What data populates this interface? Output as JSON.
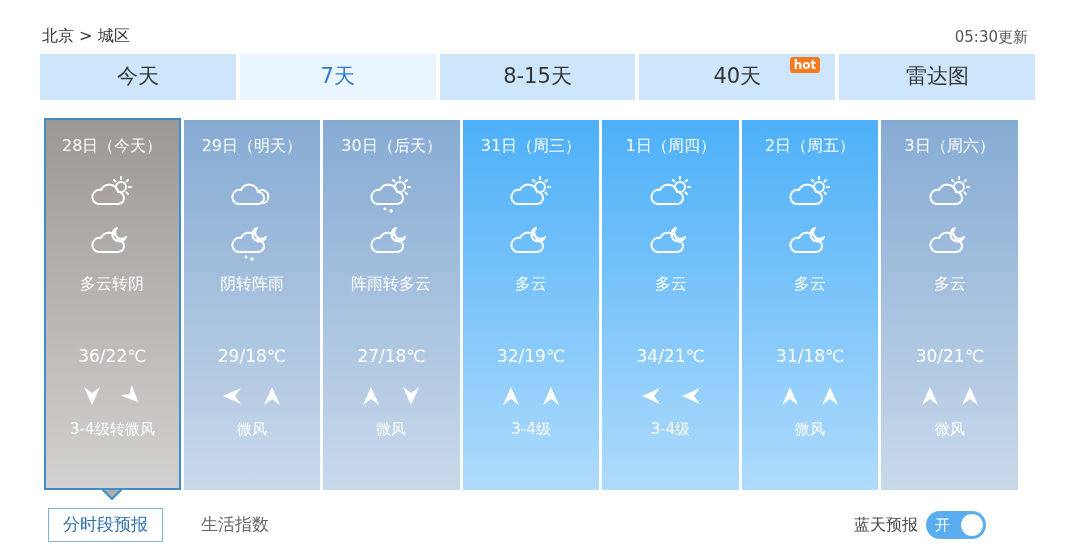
{
  "breadcrumb": "北京 > 城区",
  "updated": "05:30更新",
  "tabs": [
    {
      "label": "今天",
      "selected": false
    },
    {
      "label": "7天",
      "selected": true
    },
    {
      "label": "8-15天",
      "selected": false
    },
    {
      "label": "40天",
      "selected": false,
      "badge": "hot"
    },
    {
      "label": "雷达图",
      "selected": false
    }
  ],
  "days": [
    {
      "date": "28日（今天）",
      "selected": true,
      "color": "#9d9894",
      "icons": [
        {
          "kind": "suncloud"
        },
        {
          "kind": "mooncloud"
        }
      ],
      "weather": "多云转阴",
      "temp": "36/22℃",
      "winds": [
        {
          "kind": "south"
        },
        {
          "kind": "southeast"
        }
      ],
      "wind": "3-4级转微风"
    },
    {
      "date": "29日（明天）",
      "selected": false,
      "color": "#86abd3",
      "icons": [
        {
          "kind": "cloud"
        },
        {
          "kind": "moonrain"
        }
      ],
      "weather": "阴转阵雨",
      "temp": "29/18℃",
      "winds": [
        {
          "kind": "west"
        },
        {
          "kind": "north"
        }
      ],
      "wind": "微风"
    },
    {
      "date": "30日（后天）",
      "selected": false,
      "color": "#86abd3",
      "icons": [
        {
          "kind": "sunrain"
        },
        {
          "kind": "mooncloud"
        }
      ],
      "weather": "阵雨转多云",
      "temp": "27/18℃",
      "winds": [
        {
          "kind": "north"
        },
        {
          "kind": "south"
        }
      ],
      "wind": "微风"
    },
    {
      "date": "31日（周三）",
      "selected": false,
      "color": "#4db0f8",
      "icons": [
        {
          "kind": "suncloud"
        },
        {
          "kind": "mooncloud"
        }
      ],
      "weather": "多云",
      "temp": "32/19℃",
      "winds": [
        {
          "kind": "north"
        },
        {
          "kind": "north"
        }
      ],
      "wind": "3-4级"
    },
    {
      "date": "1日（周四）",
      "selected": false,
      "color": "#4db0f8",
      "icons": [
        {
          "kind": "suncloud"
        },
        {
          "kind": "mooncloud"
        }
      ],
      "weather": "多云",
      "temp": "34/21℃",
      "winds": [
        {
          "kind": "west"
        },
        {
          "kind": "west"
        }
      ],
      "wind": "3-4级"
    },
    {
      "date": "2日（周五）",
      "selected": false,
      "color": "#4db0f8",
      "icons": [
        {
          "kind": "suncloud"
        },
        {
          "kind": "mooncloud"
        }
      ],
      "weather": "多云",
      "temp": "31/18℃",
      "winds": [
        {
          "kind": "north"
        },
        {
          "kind": "north"
        }
      ],
      "wind": "微风"
    },
    {
      "date": "3日（周六）",
      "selected": false,
      "color": "#86abd3",
      "icons": [
        {
          "kind": "suncloud"
        },
        {
          "kind": "mooncloud"
        }
      ],
      "weather": "多云",
      "temp": "30/21℃",
      "winds": [
        {
          "kind": "north"
        },
        {
          "kind": "north"
        }
      ],
      "wind": "微风"
    }
  ],
  "sub_tabs": [
    {
      "label": "分时段预报",
      "selected": true
    },
    {
      "label": "生活指数",
      "selected": false
    }
  ],
  "blue_sky": {
    "label": "蓝天预报",
    "on": true,
    "switch_text": "开"
  }
}
